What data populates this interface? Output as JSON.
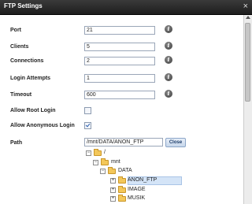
{
  "dialog": {
    "title": "FTP Settings",
    "close_glyph": "×"
  },
  "icons": {
    "info": "i",
    "toggle_minus": "−",
    "toggle_plus": "+"
  },
  "form": {
    "port": {
      "label": "Port",
      "value": "21"
    },
    "clients": {
      "label": "Clients",
      "value": "5"
    },
    "connections": {
      "label": "Connections",
      "value": "2"
    },
    "login_attempts": {
      "label": "Login Attempts",
      "value": "1"
    },
    "timeout": {
      "label": "Timeout",
      "value": "600"
    },
    "allow_root_login": {
      "label": "Allow Root Login",
      "checked": false
    },
    "allow_anonymous_login": {
      "label": "Allow Anonymous Login",
      "checked": true
    },
    "path": {
      "label": "Path",
      "value": "/mnt/DATA/ANON_FTP",
      "close_label": "Close"
    }
  },
  "tree": {
    "root": "/",
    "mnt": "mnt",
    "data": "DATA",
    "anon_ftp": "ANON_FTP",
    "image": "IMAGE",
    "musik": "MUSIK"
  }
}
